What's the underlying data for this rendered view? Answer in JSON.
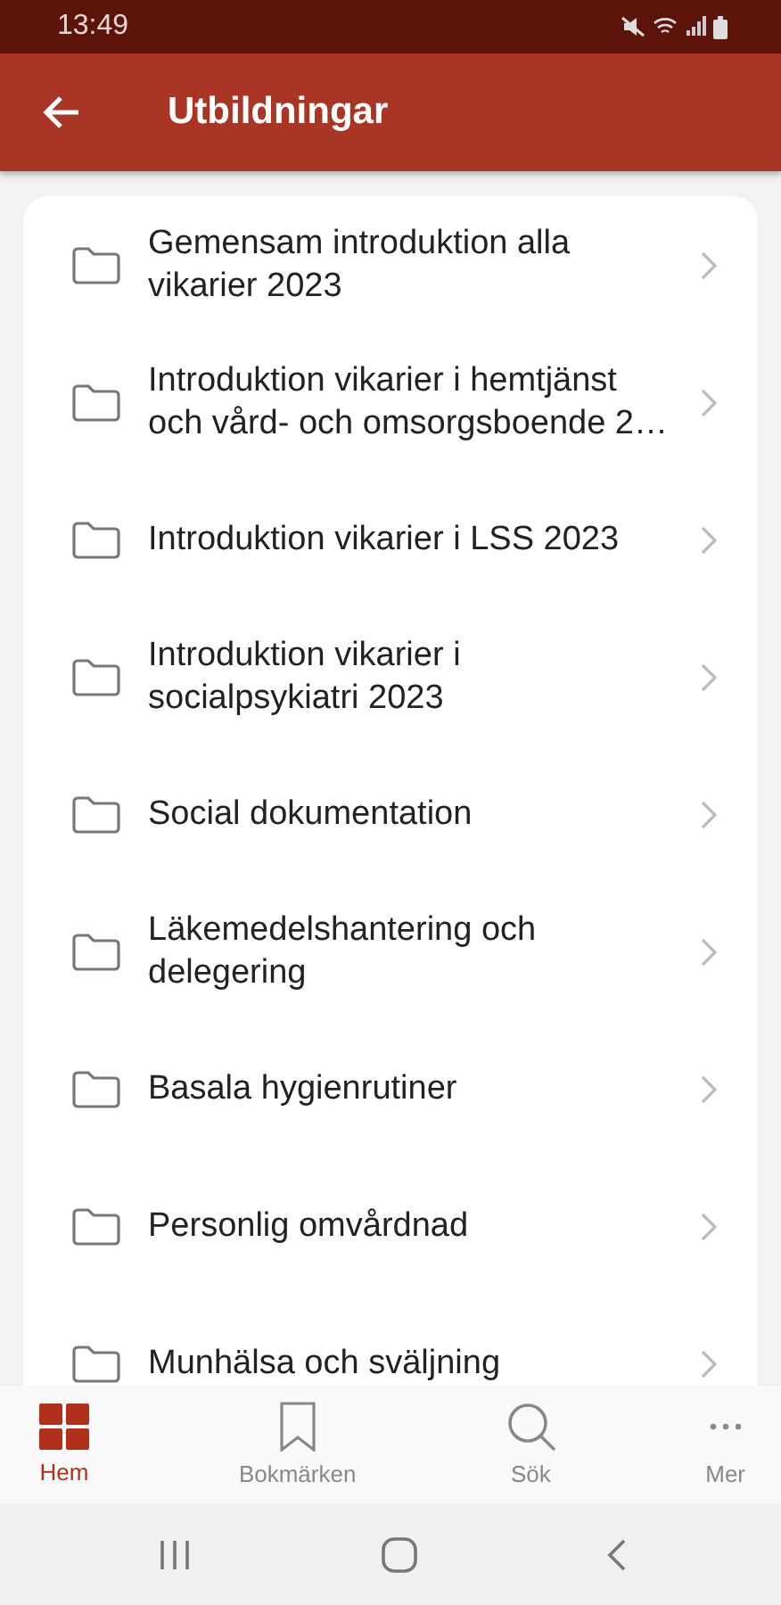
{
  "status_bar": {
    "time": "13:49"
  },
  "app_bar": {
    "title": "Utbildningar"
  },
  "items": [
    {
      "label": "Gemensam introduktion alla vikarier 2023"
    },
    {
      "label": "Introduktion vikarier i hemtjänst och vård- och omsorgsboende 2…"
    },
    {
      "label": "Introduktion vikarier i LSS 2023"
    },
    {
      "label": "Introduktion vikarier i socialpsykiatri 2023"
    },
    {
      "label": "Social dokumentation"
    },
    {
      "label": "Läkemedelshantering och delegering"
    },
    {
      "label": "Basala hygienrutiner"
    },
    {
      "label": "Personlig omvårdnad"
    },
    {
      "label": "Munhälsa och sväljning"
    }
  ],
  "bottom_nav": [
    {
      "kind": "home",
      "label": "Hem",
      "selected": true
    },
    {
      "kind": "bookmark",
      "label": "Bokmärken",
      "selected": false
    },
    {
      "kind": "search",
      "label": "Sök",
      "selected": false
    },
    {
      "kind": "more",
      "label": "Mer",
      "selected": false
    }
  ]
}
